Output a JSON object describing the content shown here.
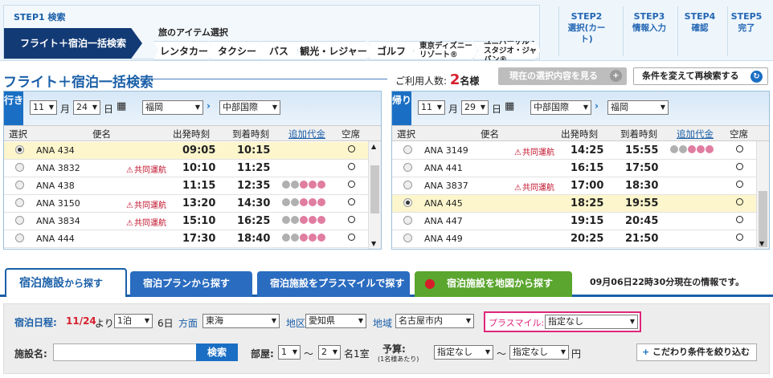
{
  "steps": {
    "step1": "STEP1 検索",
    "current": "フライト＋宿泊一括検索",
    "item_head": "旅のアイテム選択",
    "items": [
      "レンタカー",
      "タクシー",
      "バス",
      "観光・レジャー",
      "ゴルフ",
      "東京ディズニーリゾート®",
      "ユニバーサル・スタジオ・ジャパン®"
    ],
    "step2": "STEP2",
    "step2_t": "選択(カート)",
    "step3": "STEP3",
    "step3_t": "情報入力",
    "step4": "STEP4",
    "step4_t": "確認",
    "step5": "STEP5",
    "step5_t": "完了"
  },
  "search": {
    "title": "フライト＋宿泊一括検索",
    "persons_label": "ご利用人数:",
    "persons_value": "2",
    "persons_unit": "名様",
    "current_btn": "現在の選択内容を見る",
    "research_btn": "条件を変えて再検索する"
  },
  "outbound": {
    "dir": "行き",
    "month": "11",
    "month_u": "月",
    "day": "24",
    "day_u": "日",
    "from": "福岡",
    "to": "中部国際",
    "headers": [
      "選択",
      "便名",
      "出発時刻",
      "到着時刻",
      "追加代金",
      "空席"
    ],
    "rows": [
      {
        "flight": "ANA 434",
        "codeshare": "",
        "dep": "09:05",
        "arr": "10:15",
        "extra": 0,
        "selected": true
      },
      {
        "flight": "ANA 3832",
        "codeshare": "共同運航",
        "dep": "10:10",
        "arr": "11:25",
        "extra": 0,
        "selected": false
      },
      {
        "flight": "ANA 438",
        "codeshare": "",
        "dep": "11:15",
        "arr": "12:35",
        "extra": 5,
        "selected": false
      },
      {
        "flight": "ANA 3150",
        "codeshare": "共同運航",
        "dep": "13:20",
        "arr": "14:30",
        "extra": 5,
        "selected": false
      },
      {
        "flight": "ANA 3834",
        "codeshare": "共同運航",
        "dep": "15:10",
        "arr": "16:25",
        "extra": 5,
        "selected": false
      },
      {
        "flight": "ANA 444",
        "codeshare": "",
        "dep": "17:30",
        "arr": "18:40",
        "extra": 5,
        "selected": false
      }
    ]
  },
  "inbound": {
    "dir": "帰り",
    "month": "11",
    "month_u": "月",
    "day": "29",
    "day_u": "日",
    "from": "中部国際",
    "to": "福岡",
    "headers": [
      "選択",
      "便名",
      "出発時刻",
      "到着時刻",
      "追加代金",
      "空席"
    ],
    "rows": [
      {
        "flight": "ANA 3149",
        "codeshare": "共同運航",
        "dep": "14:25",
        "arr": "15:55",
        "extra": 5,
        "selected": false
      },
      {
        "flight": "ANA 441",
        "codeshare": "",
        "dep": "16:15",
        "arr": "17:50",
        "extra": 0,
        "selected": false
      },
      {
        "flight": "ANA 3837",
        "codeshare": "共同運航",
        "dep": "17:00",
        "arr": "18:30",
        "extra": 0,
        "selected": false
      },
      {
        "flight": "ANA 445",
        "codeshare": "",
        "dep": "18:25",
        "arr": "19:55",
        "extra": 0,
        "selected": true
      },
      {
        "flight": "ANA 447",
        "codeshare": "",
        "dep": "19:15",
        "arr": "20:45",
        "extra": 0,
        "selected": false
      },
      {
        "flight": "ANA 449",
        "codeshare": "",
        "dep": "20:25",
        "arr": "21:50",
        "extra": 0,
        "selected": false
      }
    ]
  },
  "hotel_tabs": {
    "tab1_a": "宿泊施設",
    "tab1_b": "から探す",
    "tab2": "宿泊プランから探す",
    "tab3": "宿泊施設をプラスマイルで探す",
    "tab4": "宿泊施設を地図から探す",
    "info": "09月06日22時30分現在の情報です。"
  },
  "hotel": {
    "dates_label": "宿泊日程:",
    "date": "11/24",
    "yori": "より",
    "nights": "1泊",
    "day": "6日",
    "area_label": "方面",
    "area": "東海",
    "region_label": "地区",
    "region": "愛知県",
    "zone_label": "地域",
    "zone": "名古屋市内",
    "plusmile_label": "プラスマイル:",
    "plusmile": "指定なし",
    "name_label": "施設名:",
    "name_value": "",
    "search_btn": "検索",
    "room_label": "部屋:",
    "room_from": "1",
    "tilde": "〜",
    "room_to": "2",
    "room_unit": "名1室",
    "budget_label": "予算:",
    "budget_sub": "(1名様あたり)",
    "budget_from": "指定なし",
    "budget_to": "指定なし",
    "yen": "円",
    "narrow_btn": "こだわり条件を絞り込む"
  }
}
